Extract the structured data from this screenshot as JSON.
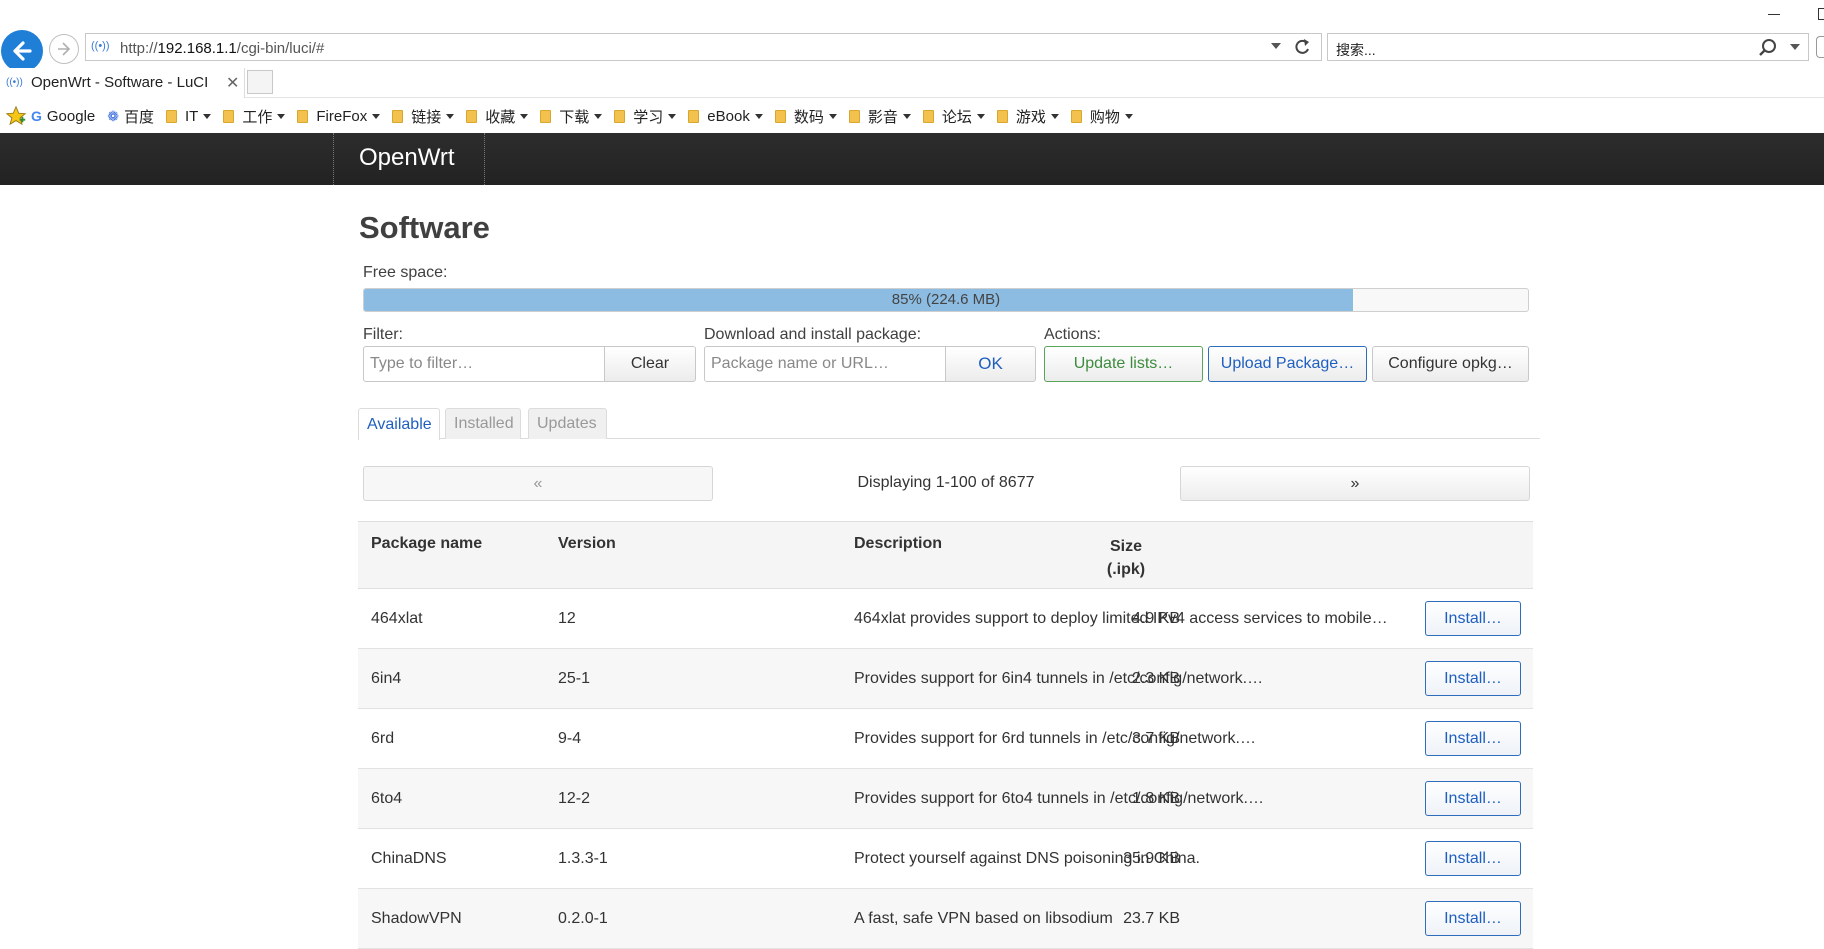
{
  "browser": {
    "url_prefix": "http://",
    "url_host": "192.168.1.1",
    "url_path": "/cgi-bin/luci/#",
    "search_placeholder": "搜索...",
    "tab_title": "OpenWrt - Software - LuCI",
    "tab_close": "✕",
    "favorites": [
      {
        "label": "Google",
        "kind": "google",
        "dropdown": false
      },
      {
        "label": "百度",
        "kind": "baidu",
        "dropdown": false
      },
      {
        "label": "IT",
        "kind": "folder",
        "dropdown": true
      },
      {
        "label": "工作",
        "kind": "folder",
        "dropdown": true
      },
      {
        "label": "FireFox",
        "kind": "folder",
        "dropdown": true
      },
      {
        "label": "链接",
        "kind": "folder",
        "dropdown": true
      },
      {
        "label": "收藏",
        "kind": "folder",
        "dropdown": true
      },
      {
        "label": "下载",
        "kind": "folder",
        "dropdown": true
      },
      {
        "label": "学习",
        "kind": "folder",
        "dropdown": true
      },
      {
        "label": "eBook",
        "kind": "folder",
        "dropdown": true
      },
      {
        "label": "数码",
        "kind": "folder",
        "dropdown": true
      },
      {
        "label": "影音",
        "kind": "folder",
        "dropdown": true
      },
      {
        "label": "论坛",
        "kind": "folder",
        "dropdown": true
      },
      {
        "label": "游戏",
        "kind": "folder",
        "dropdown": true
      },
      {
        "label": "购物",
        "kind": "folder",
        "dropdown": true
      }
    ]
  },
  "header": {
    "brand": "OpenWrt"
  },
  "page": {
    "title": "Software",
    "free_space_label": "Free space:",
    "free_space_percent": 85,
    "free_space_text": "85% (224.6 MB)",
    "filter_label": "Filter:",
    "filter_placeholder": "Type to filter…",
    "clear_label": "Clear",
    "download_label": "Download and install package:",
    "download_placeholder": "Package name or URL…",
    "ok_label": "OK",
    "actions_label": "Actions:",
    "update_lists_label": "Update lists…",
    "upload_package_label": "Upload Package…",
    "configure_opkg_label": "Configure opkg…",
    "tabs": [
      "Available",
      "Installed",
      "Updates"
    ],
    "pager_prev": "«",
    "pager_next": "»",
    "pager_text": "Displaying 1-100 of 8677"
  },
  "table": {
    "headers": {
      "name": "Package name",
      "version": "Version",
      "size_line1": "Size",
      "size_line2": "(.ipk)",
      "description": "Description"
    },
    "install_label": "Install…",
    "rows": [
      {
        "name": "464xlat",
        "version": "12",
        "size": "4.9 KB",
        "description": "464xlat provides support to deploy limited IPv4 access services to mobile…"
      },
      {
        "name": "6in4",
        "version": "25-1",
        "size": "2.3 KB",
        "description": "Provides support for 6in4 tunnels in /etc/config/network.…"
      },
      {
        "name": "6rd",
        "version": "9-4",
        "size": "3.7 KB",
        "description": "Provides support for 6rd tunnels in /etc/config/network.…"
      },
      {
        "name": "6to4",
        "version": "12-2",
        "size": "1.8 KB",
        "description": "Provides support for 6to4 tunnels in /etc/config/network.…"
      },
      {
        "name": "ChinaDNS",
        "version": "1.3.3-1",
        "size": "35.9 KB",
        "description": "Protect yourself against DNS poisoning in China."
      },
      {
        "name": "ShadowVPN",
        "version": "0.2.0-1",
        "size": "23.7 KB",
        "description": "A fast, safe VPN based on libsodium"
      }
    ]
  },
  "colors": {
    "accent_blue": "#1f5fbf",
    "green": "#3d8b3d",
    "header_bg": "#222222",
    "progress_fill": "#8dbce3"
  }
}
